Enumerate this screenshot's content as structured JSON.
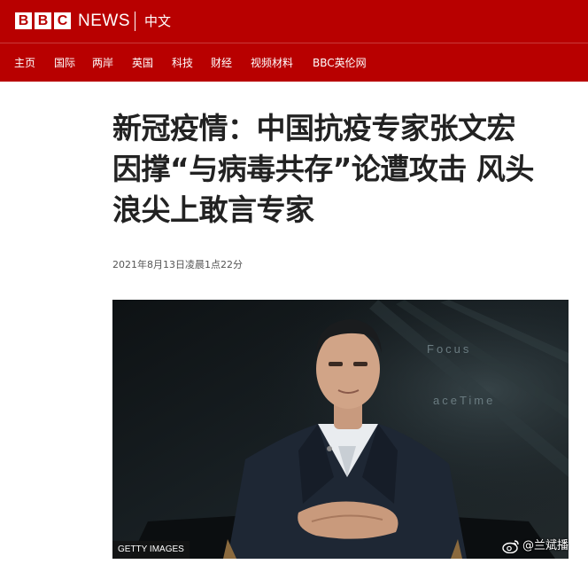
{
  "masthead": {
    "logo_letters": [
      "B",
      "B",
      "C"
    ],
    "news": "NEWS",
    "language": "中文"
  },
  "nav": {
    "items": [
      "主页",
      "国际",
      "两岸",
      "英国",
      "科技",
      "财经",
      "视频材料",
      "BBC英伦网"
    ]
  },
  "article": {
    "headline_lines": [
      "新冠疫情：中国抗疫专家张文宏",
      "因撑“与病毒共存”论遭攻击 风头",
      "浪尖上敢言专家"
    ],
    "timestamp": "2021年8月13日凌晨1点22分",
    "image": {
      "credit": "GETTY IMAGES",
      "backdrop_text": [
        "Focus",
        "aceTime"
      ]
    }
  },
  "watermark": {
    "icon": "weibo-icon",
    "handle": "@兰斌播"
  },
  "colors": {
    "brand_red": "#b80000",
    "headline": "#222222",
    "timestamp": "#555555"
  }
}
